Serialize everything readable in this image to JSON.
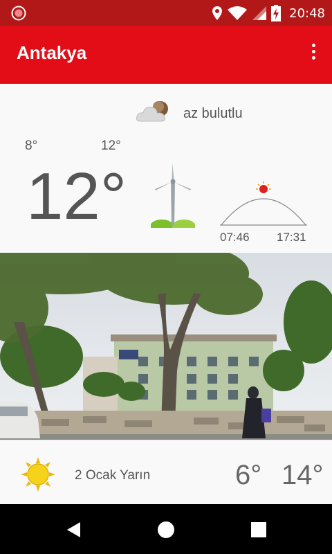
{
  "status_bar": {
    "time": "20:48",
    "icons": [
      "record-icon",
      "location-icon",
      "wifi-icon",
      "signal-icon",
      "battery-charging-icon"
    ]
  },
  "app_bar": {
    "title": "Antakya",
    "menu_icon": "more-vert-icon"
  },
  "current": {
    "condition": "az bulutlu",
    "condition_icon": "partly-cloudy-icon",
    "low": "8°",
    "high": "12°",
    "temperature": "12°",
    "wind_icon": "wind-turbine-icon",
    "sunrise": "07:46",
    "sunset": "17:31"
  },
  "photo": {
    "icon": "city-street-photo"
  },
  "forecast": {
    "icon": "sun-icon",
    "date": "2 Ocak Yarın",
    "low": "6°",
    "high": "14°"
  },
  "nav_bar": {
    "buttons": [
      "back-icon",
      "home-icon",
      "recents-icon"
    ]
  },
  "colors": {
    "status_bar": "#b31818",
    "app_bar": "#e20d16",
    "text": "#555555",
    "sun": "#f5d31a"
  }
}
